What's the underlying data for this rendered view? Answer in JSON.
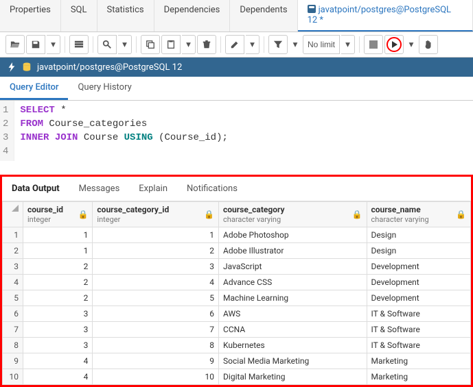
{
  "top_tabs": {
    "properties": "Properties",
    "sql": "SQL",
    "statistics": "Statistics",
    "dependencies": "Dependencies",
    "dependents": "Dependents",
    "query_tool": "javatpoint/postgres@PostgreSQL 12 *"
  },
  "toolbar": {
    "no_limit": "No limit"
  },
  "connection": {
    "label": "javatpoint/postgres@PostgreSQL 12"
  },
  "editor_tabs": {
    "query_editor": "Query Editor",
    "query_history": "Query History"
  },
  "sql": {
    "l1a": "SELECT",
    "l1b": " *",
    "l2a": "FROM",
    "l2b": " Course_categories",
    "l3a": "INNER",
    "l3b": " JOIN",
    "l3c": " Course ",
    "l3d": "USING",
    "l3e": " (Course_id);"
  },
  "output_tabs": {
    "data_output": "Data Output",
    "messages": "Messages",
    "explain": "Explain",
    "notifications": "Notifications"
  },
  "columns": {
    "c1": {
      "name": "course_id",
      "type": "integer"
    },
    "c2": {
      "name": "course_category_id",
      "type": "integer"
    },
    "c3": {
      "name": "course_category",
      "type": "character varying"
    },
    "c4": {
      "name": "course_name",
      "type": "character varying"
    }
  },
  "rows": [
    {
      "n": "1",
      "c1": "1",
      "c2": "1",
      "c3": "Adobe Photoshop",
      "c4": "Design"
    },
    {
      "n": "2",
      "c1": "1",
      "c2": "2",
      "c3": "Adobe Illustrator",
      "c4": "Design"
    },
    {
      "n": "3",
      "c1": "2",
      "c2": "3",
      "c3": "JavaScript",
      "c4": "Development"
    },
    {
      "n": "4",
      "c1": "2",
      "c2": "4",
      "c3": "Advance CSS",
      "c4": "Development"
    },
    {
      "n": "5",
      "c1": "2",
      "c2": "5",
      "c3": "Machine Learning",
      "c4": "Development"
    },
    {
      "n": "6",
      "c1": "3",
      "c2": "6",
      "c3": "AWS",
      "c4": "IT & Software"
    },
    {
      "n": "7",
      "c1": "3",
      "c2": "7",
      "c3": "CCNA",
      "c4": "IT & Software"
    },
    {
      "n": "8",
      "c1": "3",
      "c2": "8",
      "c3": "Kubernetes",
      "c4": "IT & Software"
    },
    {
      "n": "9",
      "c1": "4",
      "c2": "9",
      "c3": "Social Media Marketing",
      "c4": "Marketing"
    },
    {
      "n": "10",
      "c1": "4",
      "c2": "10",
      "c3": "Digital Marketing",
      "c4": "Marketing"
    }
  ]
}
